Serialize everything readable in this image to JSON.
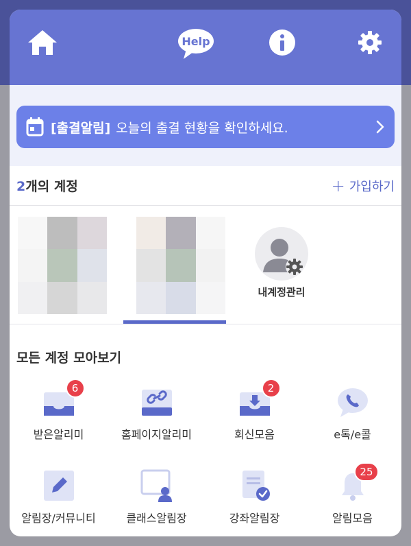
{
  "topbar": {
    "icons": [
      "home-icon",
      "help-icon",
      "info-icon",
      "gear-icon"
    ],
    "help_label": "Help",
    "info_label": "i"
  },
  "attendance": {
    "tag": "[출결알림]",
    "message": "오늘의 출결 현황을 확인하세요."
  },
  "accounts": {
    "count_num": "2",
    "count_text": "개의 계정",
    "join_label": "가입하기",
    "my_account_label": "내계정관리"
  },
  "section": {
    "title": "모든 계정 모아보기"
  },
  "menu": {
    "items": [
      {
        "label": "받은알리미",
        "icon": "inbox-icon",
        "badge": "6"
      },
      {
        "label": "홈페이지알리미",
        "icon": "link-icon",
        "badge": ""
      },
      {
        "label": "회신모음",
        "icon": "reply-icon",
        "badge": "2"
      },
      {
        "label": "e톡/e콜",
        "icon": "phone-chat-icon",
        "badge": ""
      },
      {
        "label": "알림장/커뮤니티",
        "icon": "pencil-icon",
        "badge": ""
      },
      {
        "label": "클래스알림장",
        "icon": "class-icon",
        "badge": ""
      },
      {
        "label": "강좌알림장",
        "icon": "course-check-icon",
        "badge": ""
      },
      {
        "label": "알림모음",
        "icon": "bell-icon",
        "badge": "25"
      }
    ]
  },
  "colors": {
    "primary": "#6774d2",
    "banner": "#6c80e8",
    "accent_text": "#5a69c9",
    "badge": "#e8404a"
  }
}
